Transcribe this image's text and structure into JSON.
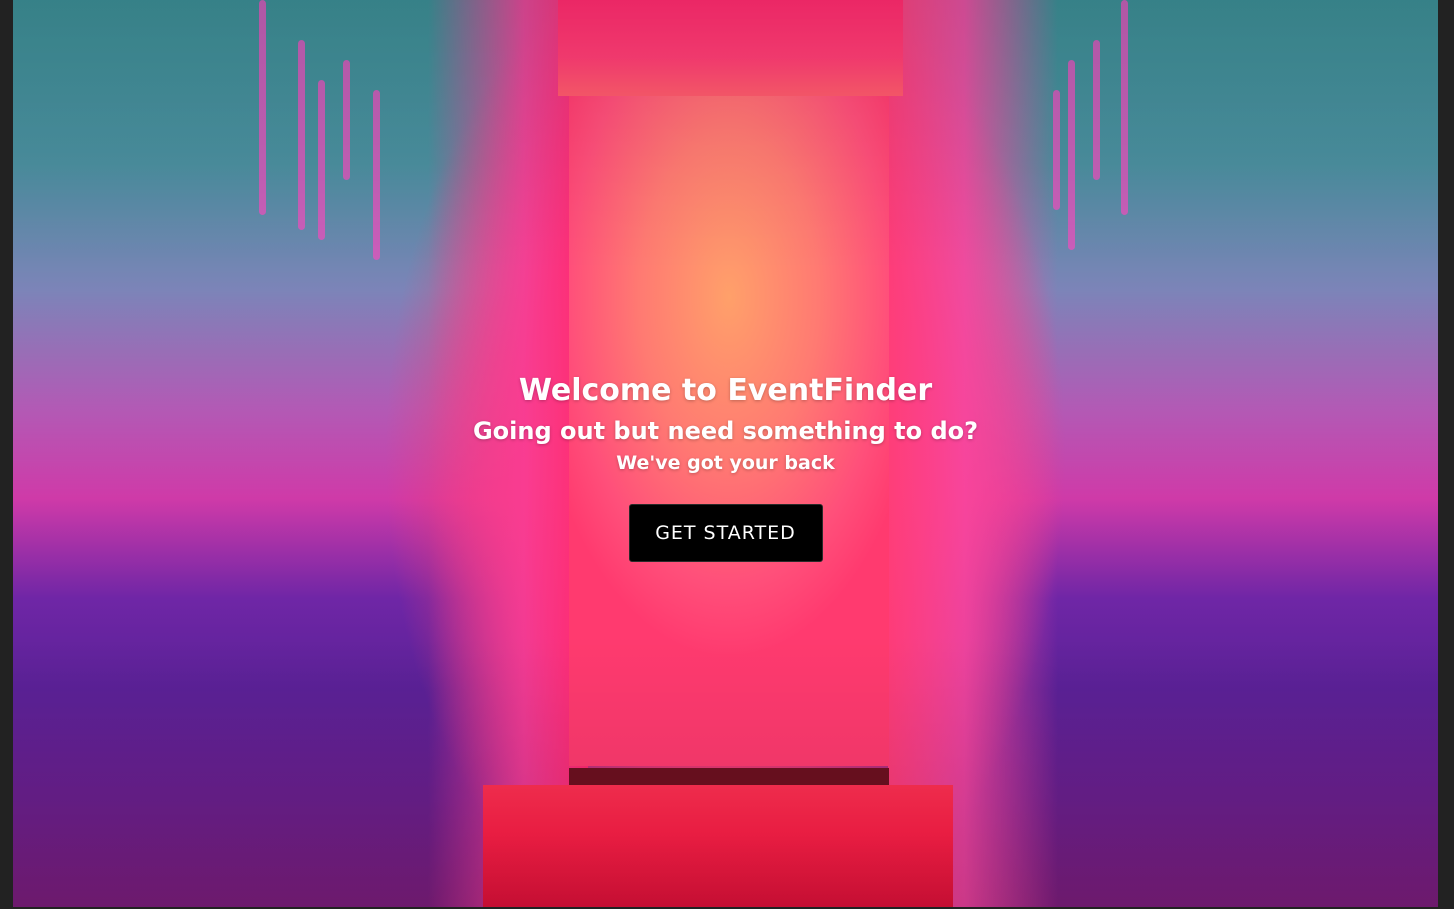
{
  "hero": {
    "title": "Welcome to EventFinder",
    "subtitle": "Going out but need something to do?",
    "tagline": "We've got your back",
    "cta_label": "GET STARTED"
  },
  "colors": {
    "page_frame": "#222222",
    "button_background": "#000000",
    "text": "#ffffff"
  }
}
